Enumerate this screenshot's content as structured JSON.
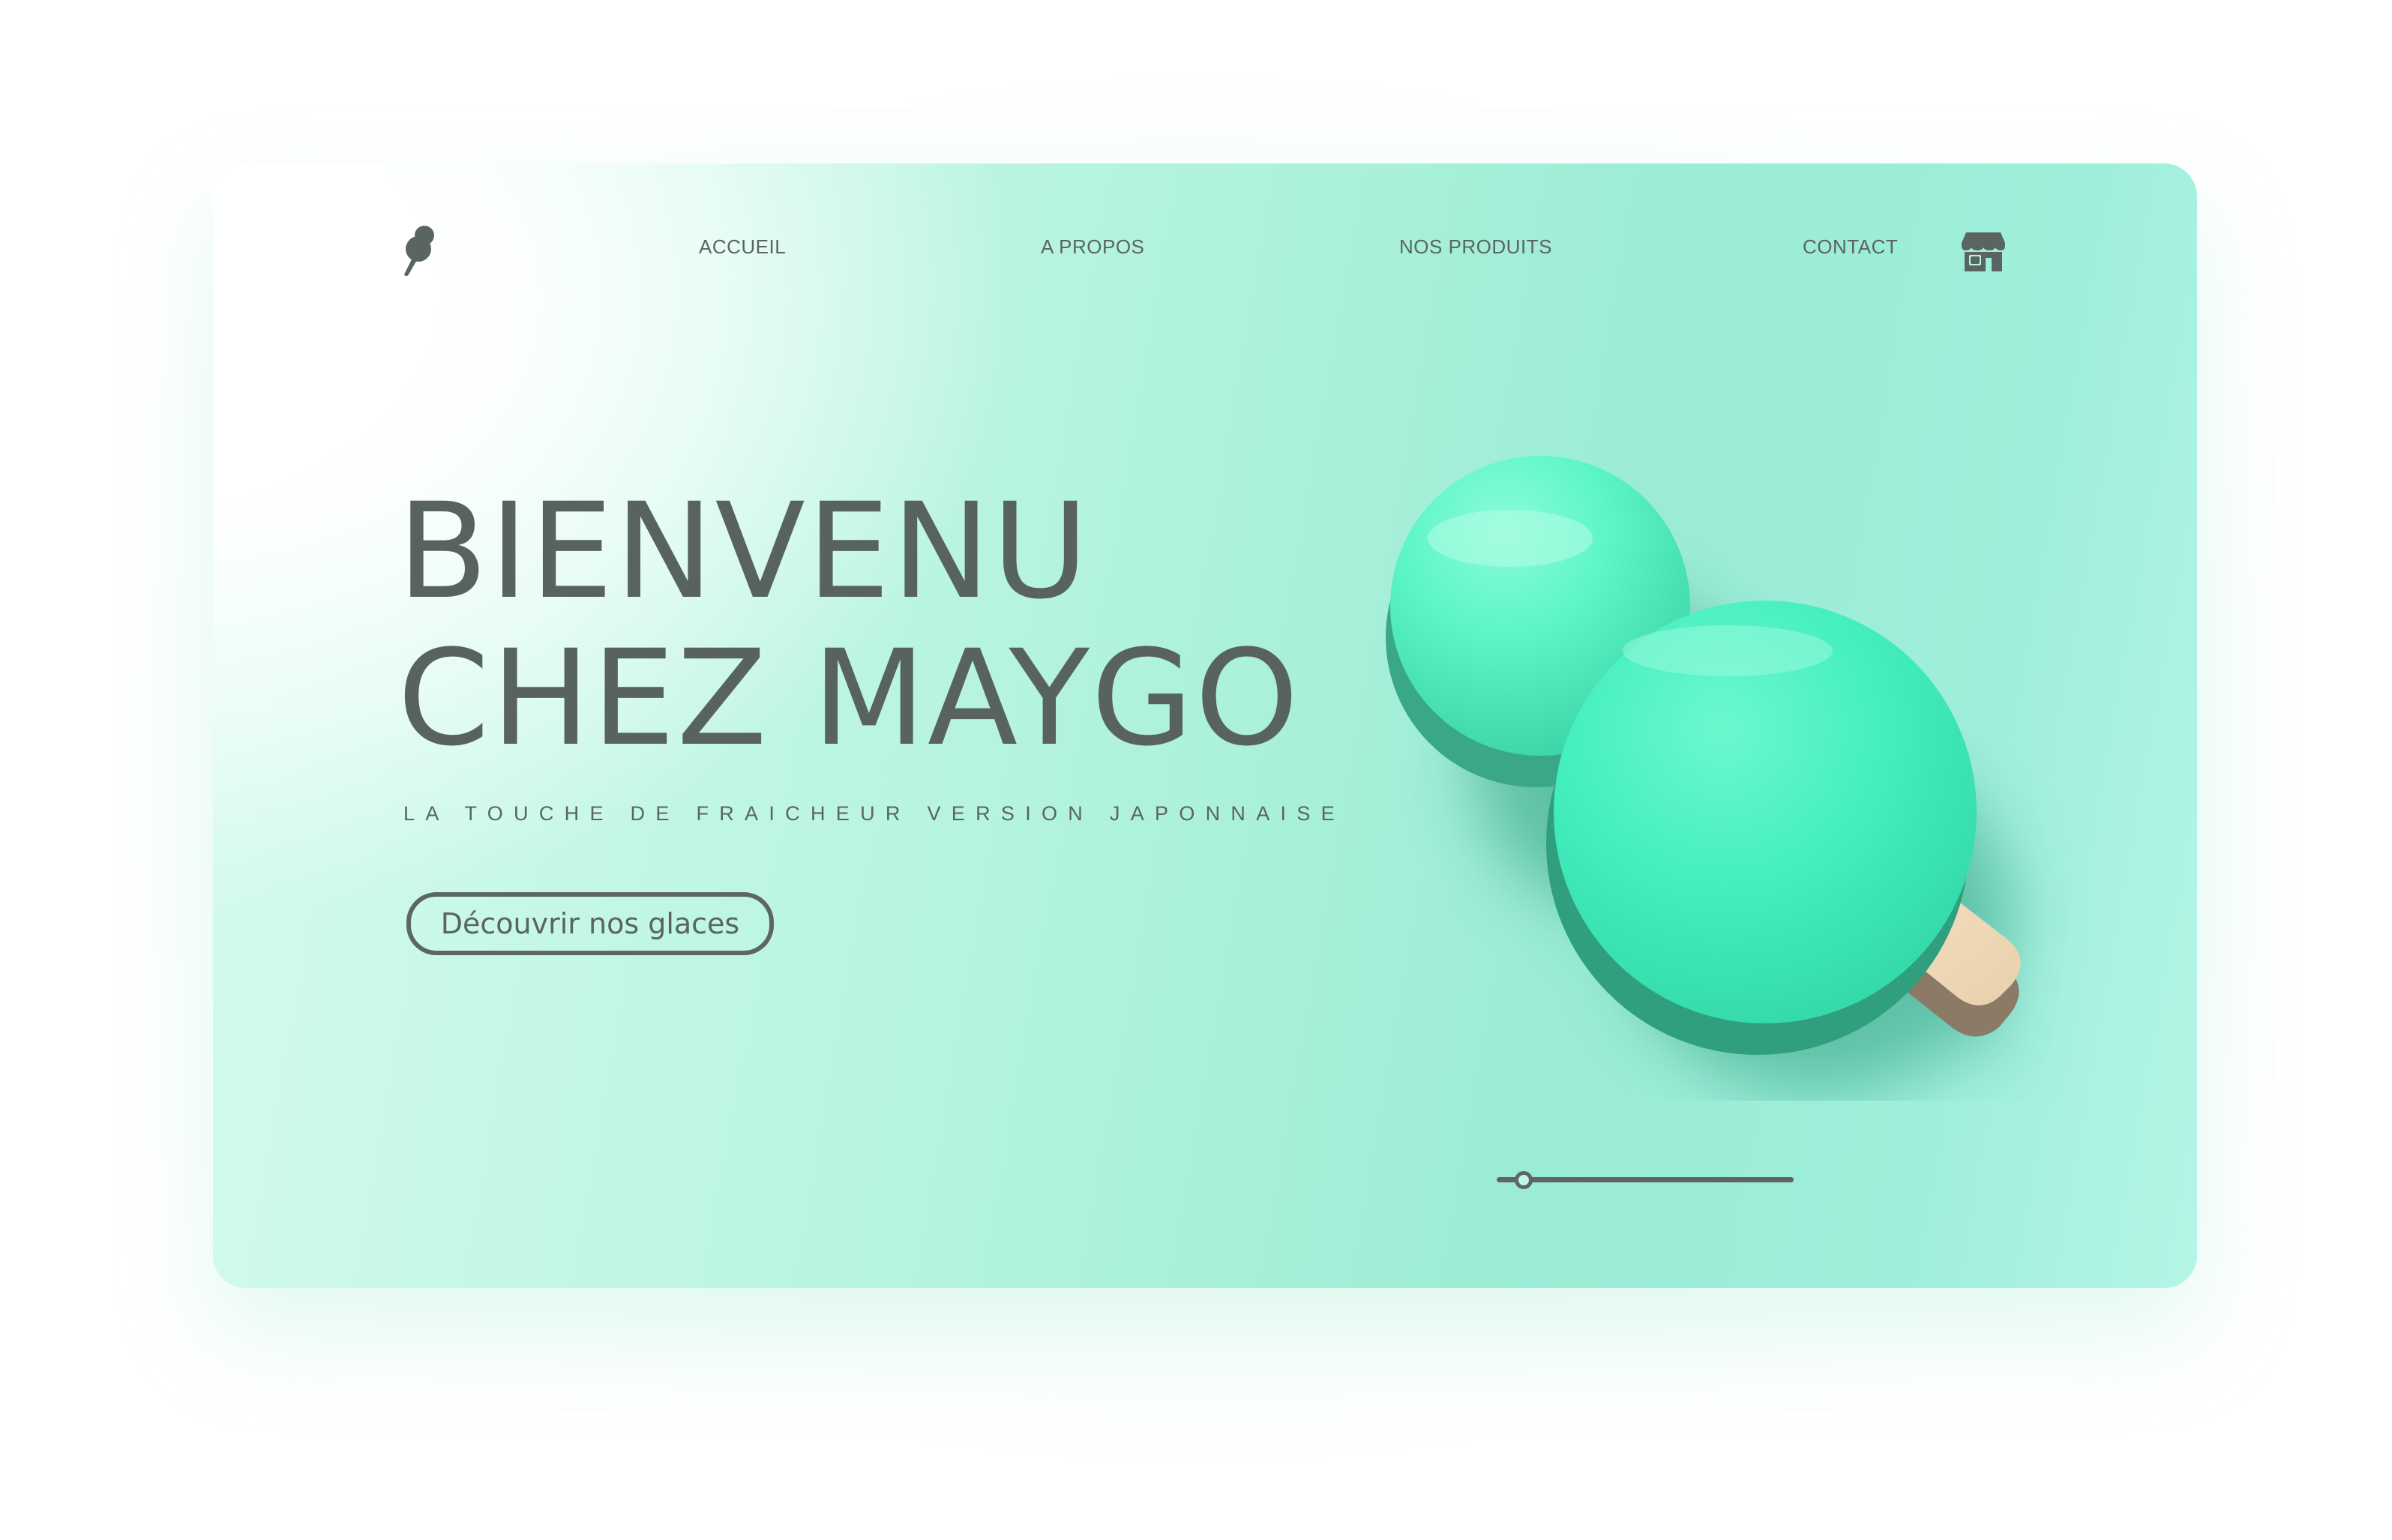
{
  "nav": {
    "logo": "popsicle-logo-icon",
    "links": [
      {
        "label": "ACCUEIL"
      },
      {
        "label": "A PROPOS"
      },
      {
        "label": "NOS PRODUITS"
      },
      {
        "label": "CONTACT"
      }
    ],
    "store_icon": "store-icon"
  },
  "hero": {
    "title_line1": "BIENVENU",
    "title_line2": "CHEZ MAYGO",
    "tagline": "LA TOUCHE DE FRAICHEUR VERSION JAPONNAISE",
    "cta_label": "Découvrir nos glaces",
    "image": "mint-popsicle-illustration"
  },
  "carousel": {
    "slide_progress": 0.06
  },
  "colors": {
    "text": "#5a6461",
    "mint": "#45efc0",
    "mint_dark": "#2f9f7e",
    "stick": "#f1dcbc",
    "background_light": "#d7fbef",
    "background_accent": "#9becd5"
  }
}
